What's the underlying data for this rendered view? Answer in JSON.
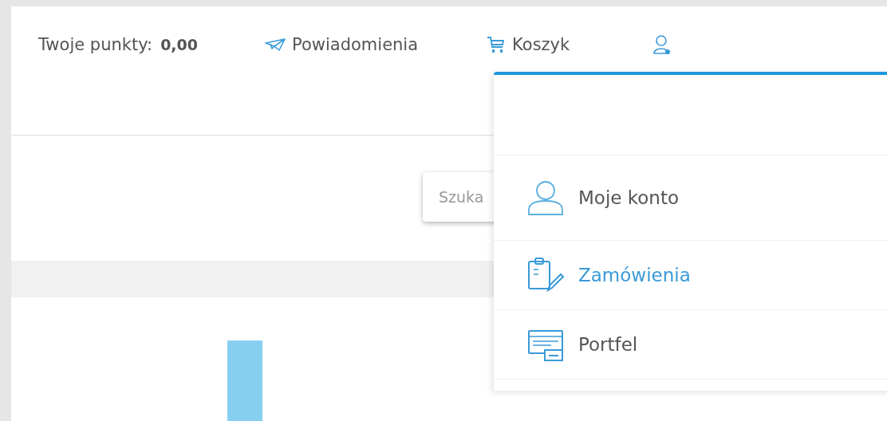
{
  "header": {
    "points_label": "Twoje punkty:",
    "points_value": "0,00",
    "links": [
      {
        "kind": "plane",
        "label": "Powiadomienia"
      },
      {
        "kind": "cart",
        "label": "Koszyk"
      }
    ]
  },
  "search": {
    "placeholder": "Szuka"
  },
  "user_menu": {
    "items": [
      {
        "kind": "user",
        "label": "Moje konto",
        "selected": false
      },
      {
        "kind": "orders",
        "label": "Zamówienia",
        "selected": true
      },
      {
        "kind": "wallet",
        "label": "Portfel",
        "selected": false
      }
    ]
  }
}
